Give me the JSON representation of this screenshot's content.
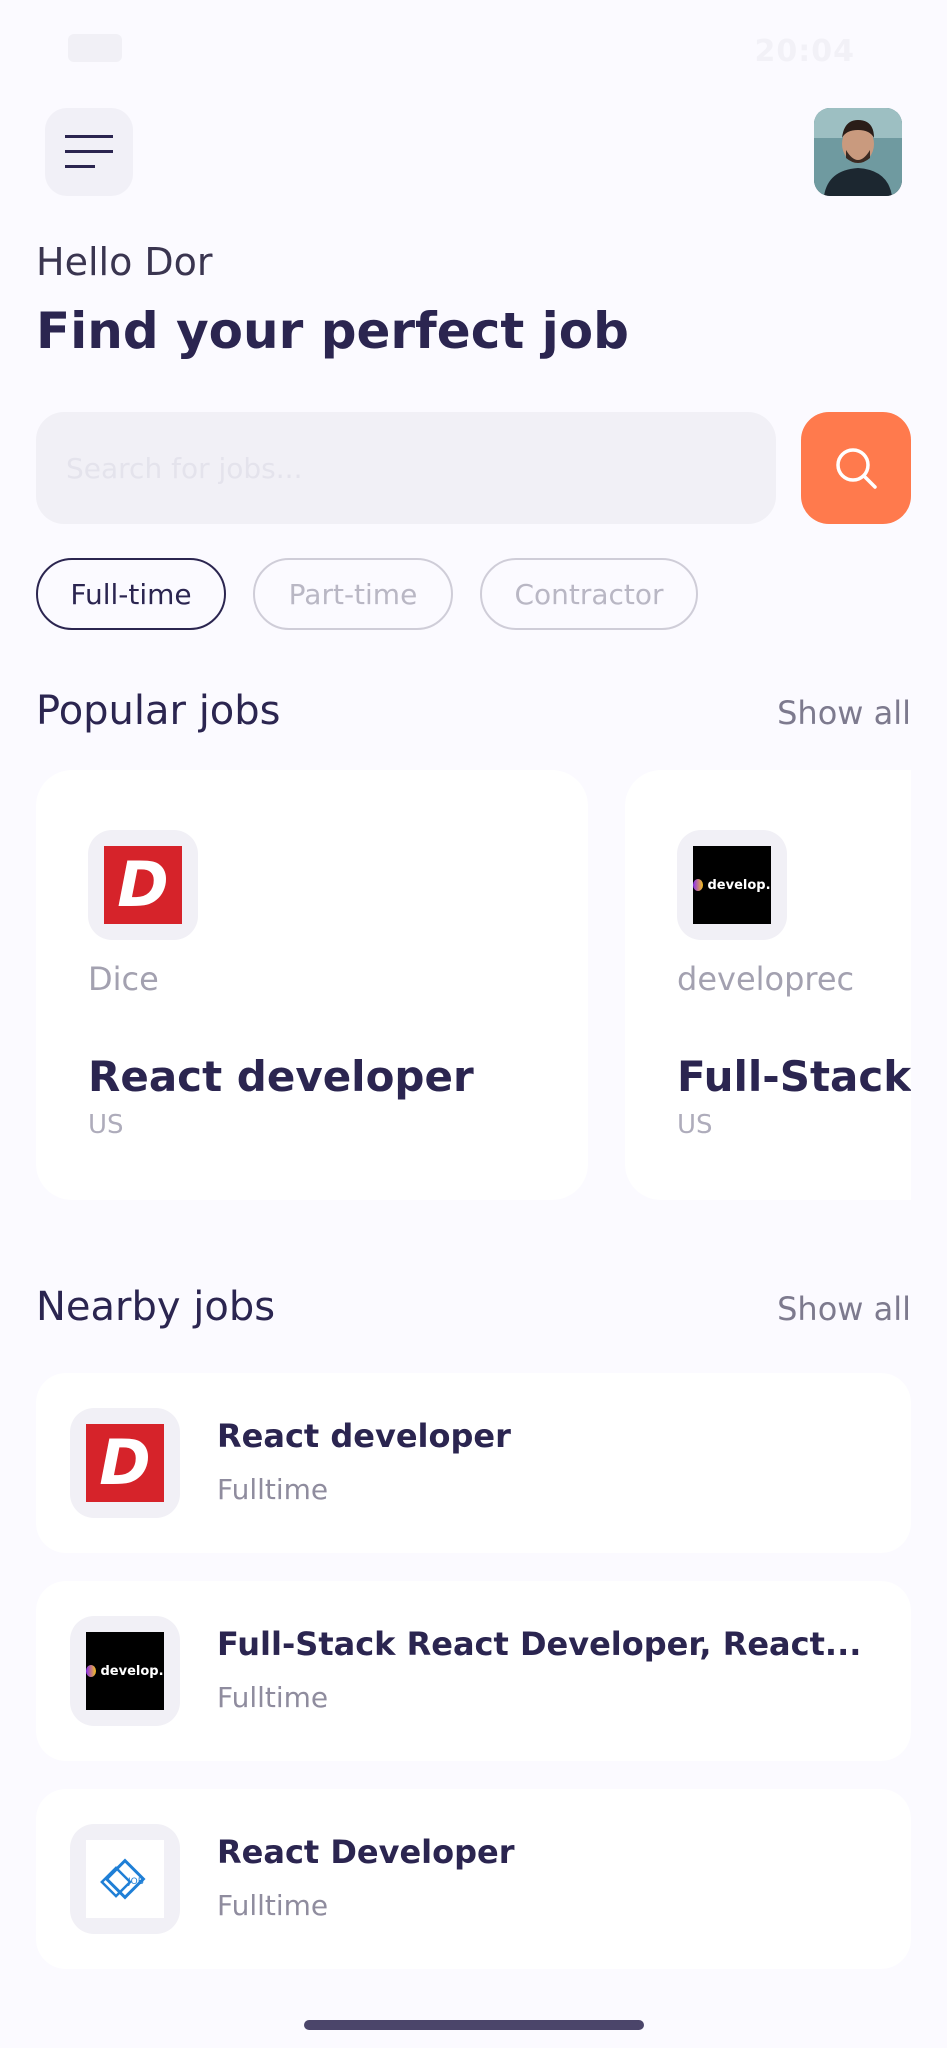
{
  "status_bar": {
    "time": "20:04"
  },
  "header": {
    "greeting": "Hello Dor",
    "headline": "Find your perfect job"
  },
  "search": {
    "placeholder": "Search for jobs...",
    "value": ""
  },
  "filters": [
    {
      "label": "Full-time",
      "active": true
    },
    {
      "label": "Part-time",
      "active": false
    },
    {
      "label": "Contractor",
      "active": false
    }
  ],
  "popular": {
    "title": "Popular jobs",
    "show_all": "Show all",
    "cards": [
      {
        "company": "Dice",
        "title": "React developer",
        "location": "US",
        "logo": "dice-logo"
      },
      {
        "company": "developrec",
        "title": "Full-Stack R",
        "location": "US",
        "logo": "develop-logo"
      }
    ]
  },
  "nearby": {
    "title": "Nearby jobs",
    "show_all": "Show all",
    "items": [
      {
        "title": "React developer",
        "type": "Fulltime",
        "logo": "dice-logo"
      },
      {
        "title": "Full-Stack React Developer, React...",
        "type": "Fulltime",
        "logo": "develop-logo"
      },
      {
        "title": "React Developer",
        "type": "Fulltime",
        "logo": "job-logo"
      }
    ]
  },
  "logos": {
    "dice_letter": "D",
    "develop_text": "develop.",
    "job_text": "JOB"
  },
  "colors": {
    "accent": "#ff7a4d",
    "primary_text": "#2b2550",
    "background": "#fbfaff"
  }
}
